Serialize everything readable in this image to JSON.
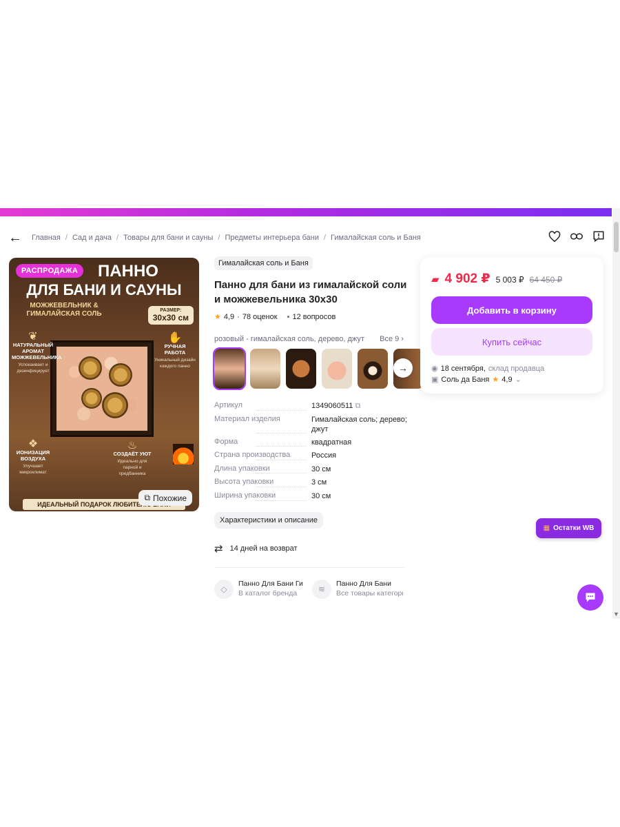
{
  "breadcrumbs": [
    "Главная",
    "Сад и дача",
    "Товары для бани и сауны",
    "Предметы интерьера бани",
    "Гималайская соль и Баня"
  ],
  "gallery": {
    "sale_badge": "РАСПРОДАЖА",
    "headline_1": "ПАННО",
    "headline_2": "ДЛЯ БАНИ И САУНЫ",
    "headline_3": "МОЖЖЕВЕЛЬНИК & ГИМАЛАЙСКАЯ СОЛЬ",
    "size_label": "РАЗМЕР:",
    "size_value": "30х30 см",
    "features": [
      {
        "title": "НАТУРАЛЬНЫЙ АРОМАТ МОЖЖЕВЕЛЬНИКА",
        "sub": "Успокаивает и дезинфицирует"
      },
      {
        "title": "РУЧНАЯ РАБОТА",
        "sub": "Уникальный дизайн каждого панно"
      },
      {
        "title": "ИОНИЗАЦИЯ ВОЗДУХА",
        "sub": "Улучшает микроклимат"
      },
      {
        "title": "СОЗДАЁТ УЮТ",
        "sub": "Идеально для парной и предбанника"
      }
    ],
    "bottom_banner": "ИДЕАЛЬНЫЙ ПОДАРОК ЛЮБИТЕЛЮ БАНИ",
    "similar_label": "Похожие"
  },
  "product": {
    "brand": "Гималайская соль и Баня",
    "title": "Панно для бани из гималайской соли и можжевельника 30х30",
    "rating": "4,9",
    "reviews": "78 оценок",
    "questions": "12 вопросов",
    "variant_label": "розовый - гималайская соль, дерево, джут",
    "variant_all": "Все 9",
    "specs": [
      {
        "key": "Артикул",
        "value": "1349060511"
      },
      {
        "key": "Материал изделия",
        "value": "Гималайская соль; дерево; джут"
      },
      {
        "key": "Форма",
        "value": "квадратная"
      },
      {
        "key": "Страна производства",
        "value": "Россия"
      },
      {
        "key": "Длина упаковки",
        "value": "30 см"
      },
      {
        "key": "Высота упаковки",
        "value": "3 см"
      },
      {
        "key": "Ширина упаковки",
        "value": "30 см"
      }
    ],
    "characteristics_button": "Характеристики и описание",
    "return_text": "14 дней на возврат",
    "links": [
      {
        "title": "Панно Для Бани Ги",
        "sub": "В каталог бренда"
      },
      {
        "title": "Панно Для Бани",
        "sub": "Все товары категори"
      }
    ]
  },
  "buy_card": {
    "price": "4 902 ₽",
    "price_alt": "5 003 ₽",
    "price_old": "64 450 ₽",
    "add_to_cart": "Добавить в корзину",
    "buy_now": "Купить сейчас",
    "delivery_date": "18 сентября,",
    "delivery_source": "склад продавца",
    "seller": "Соль да Баня",
    "seller_rating": "4,9"
  },
  "ostatki_button": "Остатки WB",
  "colors": {
    "accent": "#a73afd",
    "price": "#f0284a",
    "star": "#ff9f1a"
  }
}
